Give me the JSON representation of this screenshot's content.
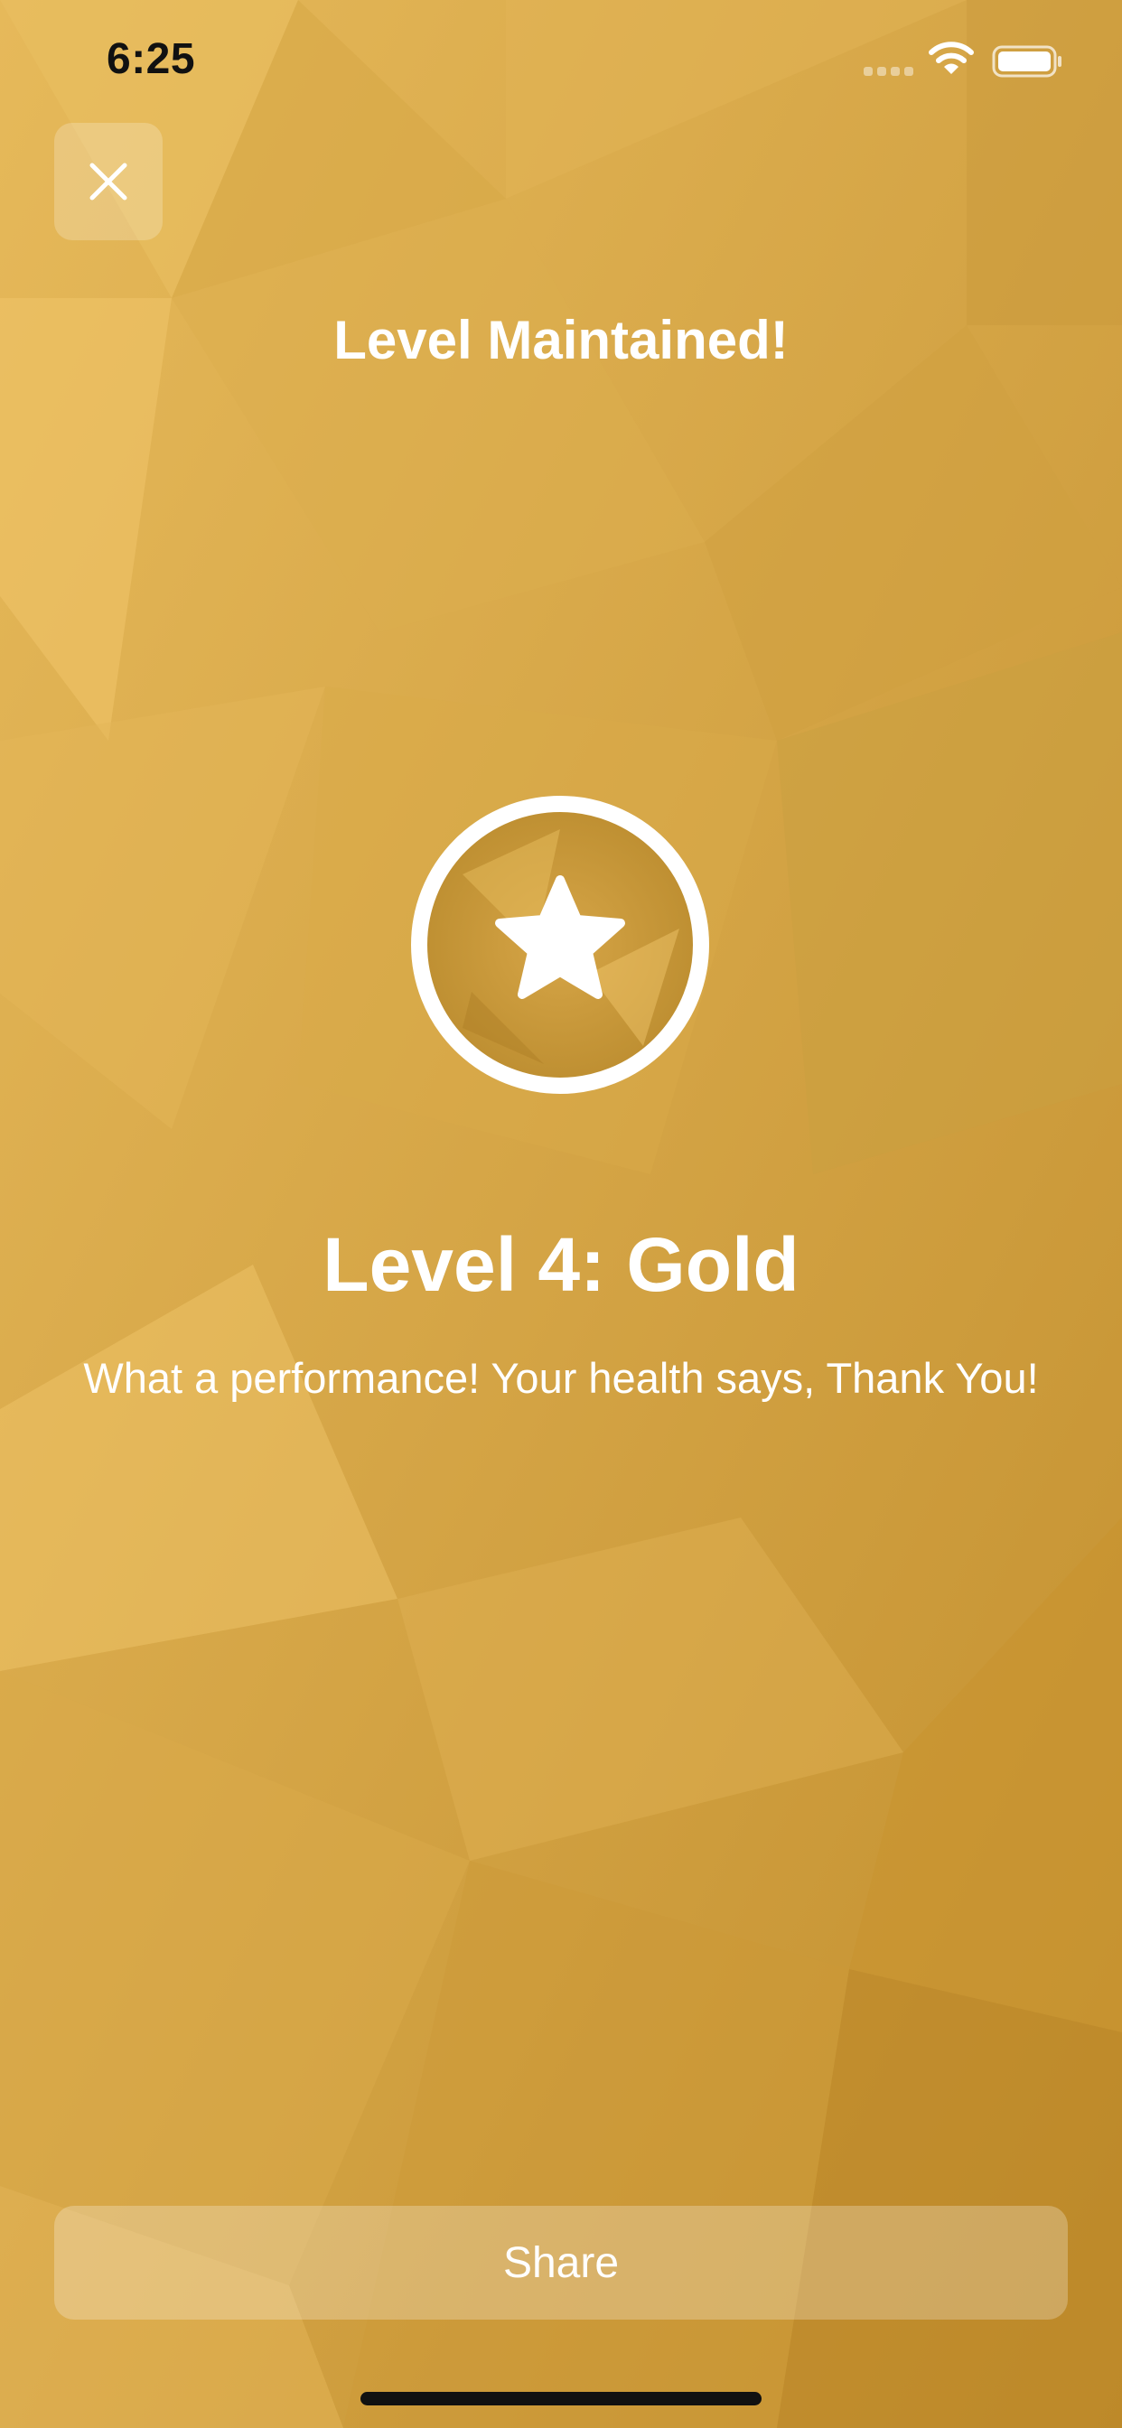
{
  "status_bar": {
    "time": "6:25",
    "signal_icon": "signal-dots-icon",
    "wifi_icon": "wifi-icon",
    "battery_icon": "battery-icon"
  },
  "close_button": {
    "icon": "close-icon"
  },
  "header": {
    "title": "Level Maintained!"
  },
  "badge": {
    "icon": "star-icon"
  },
  "level": {
    "title": "Level 4: Gold",
    "message": "What a performance! Your health says, Thank You!"
  },
  "share_button": {
    "label": "Share"
  },
  "colors": {
    "background_gold": "#d4a445",
    "text": "#ffffff",
    "status_text": "#111111"
  }
}
